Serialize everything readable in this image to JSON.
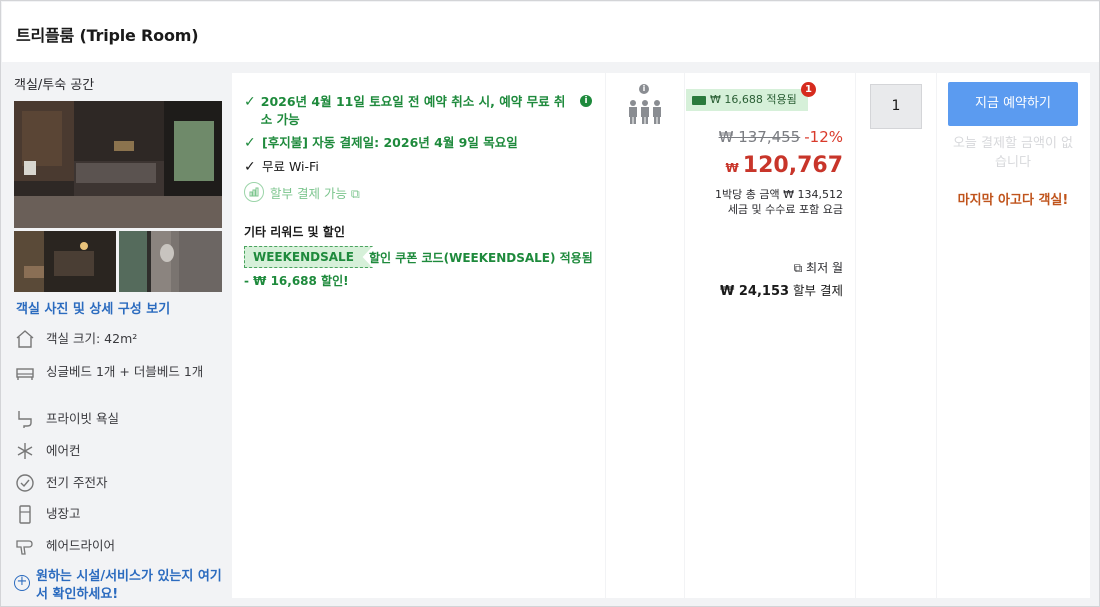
{
  "room": {
    "title": "트리플룸 (Triple Room)"
  },
  "left": {
    "section_title": "객실/투숙 공간",
    "view_link": "객실 사진 및 상세 구성 보기",
    "amenities": [
      {
        "icon": "house-icon",
        "label": "객실 크기: 42m²"
      },
      {
        "icon": "bed-icon",
        "label": "싱글베드 1개 + 더블베드 1개"
      },
      {
        "icon": "bathtub-icon",
        "label": "프라이빗 욕실"
      },
      {
        "icon": "snowflake-icon",
        "label": "에어컨"
      },
      {
        "icon": "kettle-icon",
        "label": "전기 주전자"
      },
      {
        "icon": "fridge-icon",
        "label": "냉장고"
      },
      {
        "icon": "hairdryer-icon",
        "label": "헤어드라이어"
      }
    ],
    "facility_link": "원하는 시설/서비스가 있는지 여기서 확인하세요!"
  },
  "conditions": {
    "cancel": "2026년 4월 11일 토요일 전 예약 취소 시, 예약 무료 취소 가능",
    "pay_later": "[후지불] 자동 결제일: 2026년 4월 9일 목요일",
    "wifi": "무료 Wi-Fi",
    "installment": "할부 결제 가능 ⧉",
    "other_title": "기타 리워드 및 할인",
    "coupon_code": "WEEKENDSALE",
    "coupon_text": "할인 쿠폰 코드(WEEKENDSALE) 적용됨",
    "coupon_discount": "- ₩ 16,688 할인!"
  },
  "price": {
    "promo_badge": "₩ 16,688 적용됨",
    "promo_count": "1",
    "original": "₩ 137,455",
    "discount_pct": "-12%",
    "currency": "₩",
    "final": "120,767",
    "per_night_line1": "1박당 총 금액 ₩ 134,512",
    "per_night_line2": "세금 및 수수료 포함 요금",
    "lowest_label": "⧉ 최저 월",
    "monthly_amount": "₩ 24,153",
    "monthly_suffix": " 할부 결제"
  },
  "qty": {
    "value": "1"
  },
  "book": {
    "button": "지금 예약하기",
    "no_pay_today": "오늘 결제할 금액이 없습니다",
    "last_room": "마지막 아고다 객실!"
  },
  "colors": {
    "green": "#1e8a3c",
    "link": "#2b6bbf",
    "price_red": "#c8352a",
    "button_blue": "#5b9bf0"
  }
}
